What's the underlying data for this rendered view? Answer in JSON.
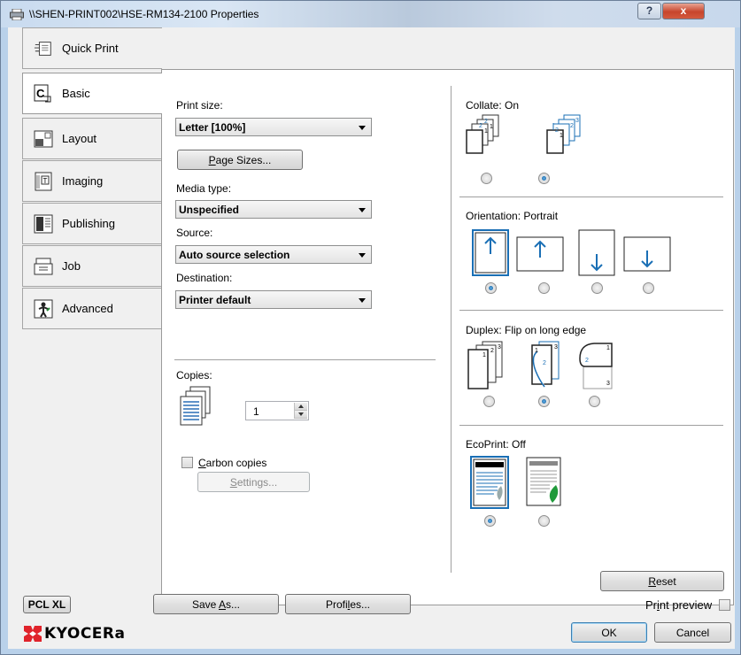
{
  "window": {
    "title": "\\\\SHEN-PRINT002\\HSE-RM134-2100 Properties",
    "help_glyph": "?",
    "close_glyph": "x"
  },
  "nav": {
    "items": [
      {
        "label": "Quick Print",
        "icon": "quick-print-icon"
      },
      {
        "label": "Basic",
        "icon": "basic-icon"
      },
      {
        "label": "Layout",
        "icon": "layout-icon"
      },
      {
        "label": "Imaging",
        "icon": "imaging-icon"
      },
      {
        "label": "Publishing",
        "icon": "publishing-icon"
      },
      {
        "label": "Job",
        "icon": "job-icon"
      },
      {
        "label": "Advanced",
        "icon": "advanced-icon"
      }
    ],
    "active": "Basic"
  },
  "print_size": {
    "label": "Print size:",
    "value": "Letter  [100%]"
  },
  "page_sizes_button": {
    "prefix": "",
    "accel": "P",
    "suffix": "age Sizes..."
  },
  "media_type": {
    "label": "Media type:",
    "value": "Unspecified"
  },
  "source": {
    "label": "Source:",
    "value": "Auto source selection"
  },
  "destination": {
    "label": "Destination:",
    "value": "Printer default"
  },
  "copies": {
    "label": "Copies:",
    "value": "1"
  },
  "carbon_copies": {
    "accel": "C",
    "rest": "arbon copies",
    "checked": false
  },
  "settings_button": {
    "accel": "S",
    "rest": "ettings..."
  },
  "collate": {
    "label": "Collate:  On",
    "selected": 1
  },
  "orientation": {
    "label": "Orientation:  Portrait",
    "selected": 0
  },
  "duplex": {
    "label": "Duplex:  Flip on long edge",
    "selected": 1
  },
  "ecoprint": {
    "label": "EcoPrint:  Off",
    "selected": 0
  },
  "reset_button": {
    "accel": "R",
    "rest": "eset"
  },
  "footer": {
    "pdl_label": "PCL XL",
    "save_as": {
      "pre": "Save ",
      "accel": "A",
      "post": "s..."
    },
    "profiles": {
      "pre": "Profi",
      "accel": "l",
      "post": "es..."
    },
    "print_preview": {
      "pre": "Pr",
      "accel": "i",
      "post": "nt preview"
    },
    "brand": "KYOCERa",
    "ok_label": "OK",
    "cancel_label": "Cancel"
  },
  "colors": {
    "accent": "#1a6fb5",
    "brand": "#e0232b",
    "leaf": "#1f9a3a"
  }
}
